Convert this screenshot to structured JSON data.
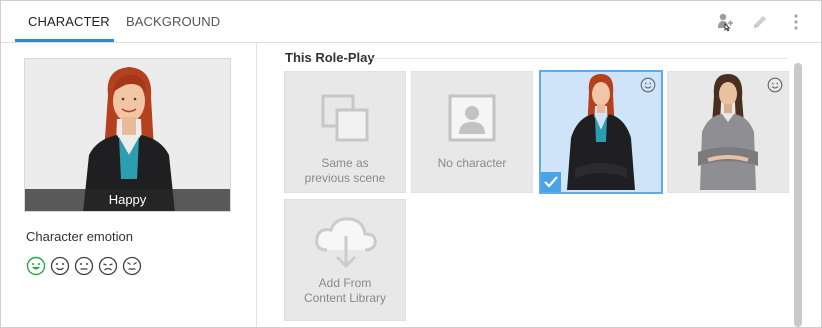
{
  "tabs": [
    {
      "label": "CHARACTER",
      "active": true
    },
    {
      "label": "BACKGROUND",
      "active": false
    }
  ],
  "toolbar": {
    "icons": [
      "add-character-icon",
      "edit-icon",
      "more-vertical-icon"
    ]
  },
  "preview": {
    "caption": "Happy",
    "image": "woman-redhead-portrait"
  },
  "emotion": {
    "label": "Character emotion",
    "options": [
      "happy",
      "content",
      "neutral",
      "sad",
      "angry"
    ],
    "selected": "happy"
  },
  "roleplay": {
    "title": "This Role-Play",
    "tiles": [
      {
        "label_line1": "Same as",
        "label_line2": "previous scene",
        "icon": "copy-scene-icon"
      },
      {
        "label": "No character",
        "icon": "no-character-icon"
      },
      {
        "image": "woman-redhead-character",
        "selected": true
      },
      {
        "image": "woman-brunette-character",
        "selected": false
      }
    ],
    "library": {
      "label_line1": "Add From",
      "label_line2": "Content Library",
      "icon": "cloud-download-icon"
    }
  },
  "colors": {
    "accent": "#2b8ad1",
    "selected_bg": "#cfe4f8",
    "selected_border": "#5aacec",
    "emotion_active": "#2aa84a"
  }
}
